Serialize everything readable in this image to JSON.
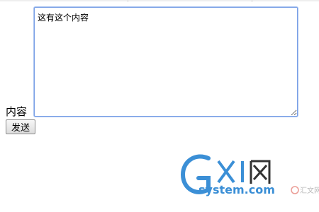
{
  "form": {
    "label": "内容",
    "textarea_value": "这有这个内容",
    "submit_label": "发送"
  },
  "watermark": {
    "brand_mark": "GXI网",
    "domain_text": "system.com",
    "faded_text": "汇文网"
  },
  "colors": {
    "focus_border": "#7aa0e6",
    "watermark_blue": "#3b8fd6",
    "watermark_red": "#d83a2b"
  }
}
